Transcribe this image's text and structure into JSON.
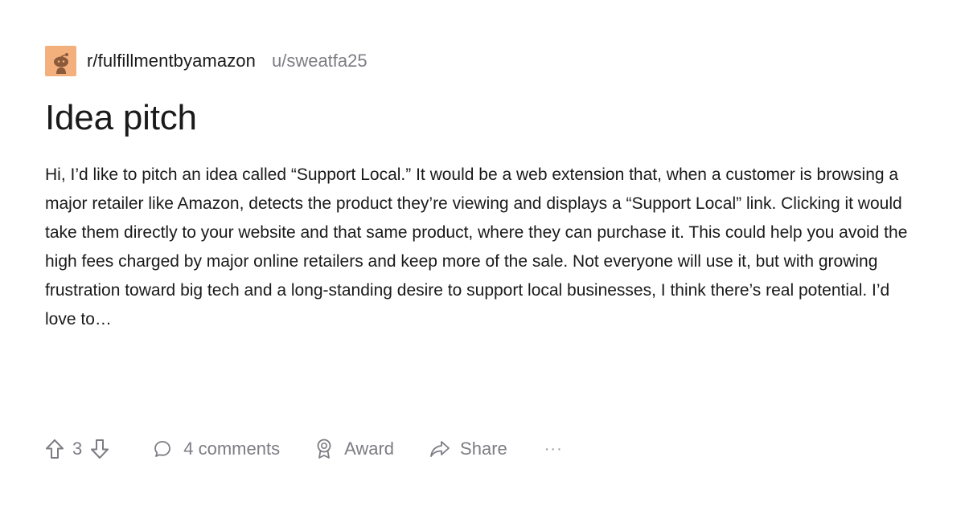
{
  "post": {
    "subreddit": "r/fulfillmentbyamazon",
    "author": "u/sweatfa25",
    "title": "Idea pitch",
    "body": "Hi, I’d like to pitch an idea called “Support Local.” It would be a web extension that, when a customer is browsing a major retailer like Amazon, detects the product they’re viewing and displays a “Support Local” link. Clicking it would take them directly to your website and that same product, where they can purchase it. This could help you avoid the high fees charged by major online retailers and keep more of the sale. Not everyone will use it, but with growing frustration toward big tech and a long-standing desire to support local businesses, I think there’s real potential. I’d love to…"
  },
  "actions": {
    "vote_count": "3",
    "comments_label": "4 comments",
    "award_label": "Award",
    "share_label": "Share",
    "more_label": "···"
  },
  "icons": {
    "avatar": "snoo-avatar-icon",
    "upvote": "arrow-up-icon",
    "downvote": "arrow-down-icon",
    "comment": "speech-bubble-icon",
    "award": "award-ribbon-icon",
    "share": "share-arrow-icon"
  },
  "colors": {
    "avatar_bg": "#f4b07c",
    "text_primary": "#1a1a1b",
    "text_muted": "#7c7c83"
  }
}
